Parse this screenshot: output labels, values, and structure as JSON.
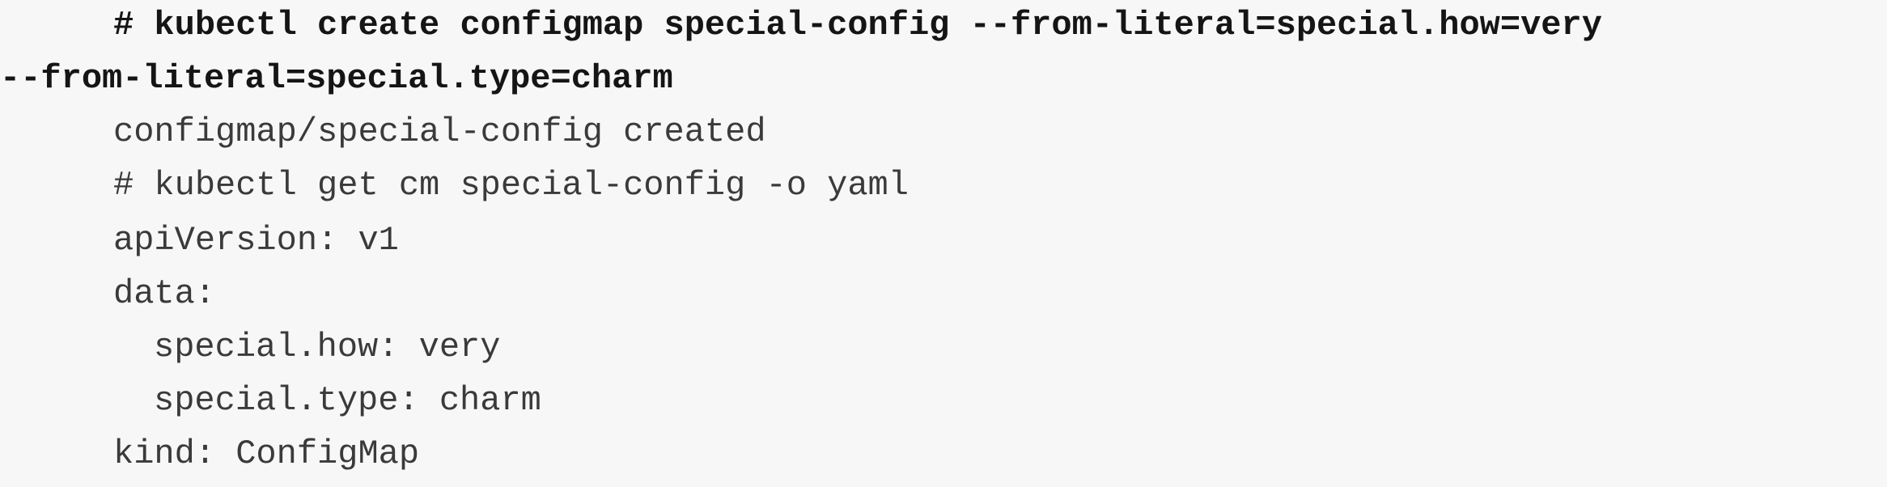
{
  "code": {
    "command_line_1": "# kubectl create configmap special-config --from-literal=special.how=very",
    "command_line_2": "--from-literal=special.type=charm",
    "output_created": "configmap/special-config created",
    "command_get": "# kubectl get cm special-config -o yaml",
    "yaml_api_version": "apiVersion: v1",
    "yaml_data": "data:",
    "yaml_special_how": "special.how: very",
    "yaml_special_type": "special.type: charm",
    "yaml_kind": "kind: ConfigMap"
  }
}
